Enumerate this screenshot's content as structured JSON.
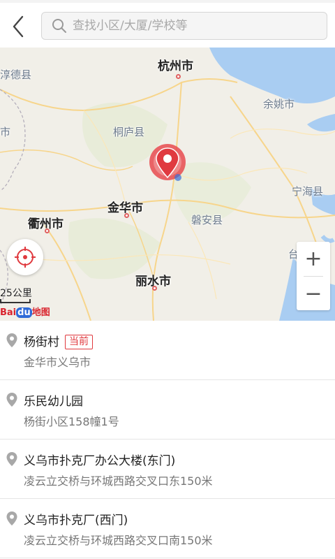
{
  "header": {
    "search_placeholder": "查找小区/大厦/学校等"
  },
  "map": {
    "cities": [
      "杭州市",
      "金华市",
      "衢州市",
      "丽水市"
    ],
    "counties": [
      "淳德县",
      "余姚市",
      "桐庐县",
      "宁海县",
      "磐安县",
      "市",
      "台"
    ],
    "scale_label": "25公里",
    "logo_text": "Bai",
    "logo_du": "du",
    "logo_map": "地图",
    "zoom_in": "+",
    "zoom_out": "−"
  },
  "results": [
    {
      "name": "杨街村",
      "badge": "当前",
      "address": "金华市义乌市"
    },
    {
      "name": "乐民幼儿园",
      "address": "杨街小区158幢1号"
    },
    {
      "name": "义乌市扑克厂办公大楼(东门)",
      "address": "凌云立交桥与环城西路交叉口东150米"
    },
    {
      "name": "义乌市扑克厂(西门)",
      "address": "凌云立交桥与环城西路交叉口南150米"
    }
  ],
  "colors": {
    "accent": "#e0393e",
    "map_bg": "#f1efe8",
    "water": "#a9cdf2"
  }
}
